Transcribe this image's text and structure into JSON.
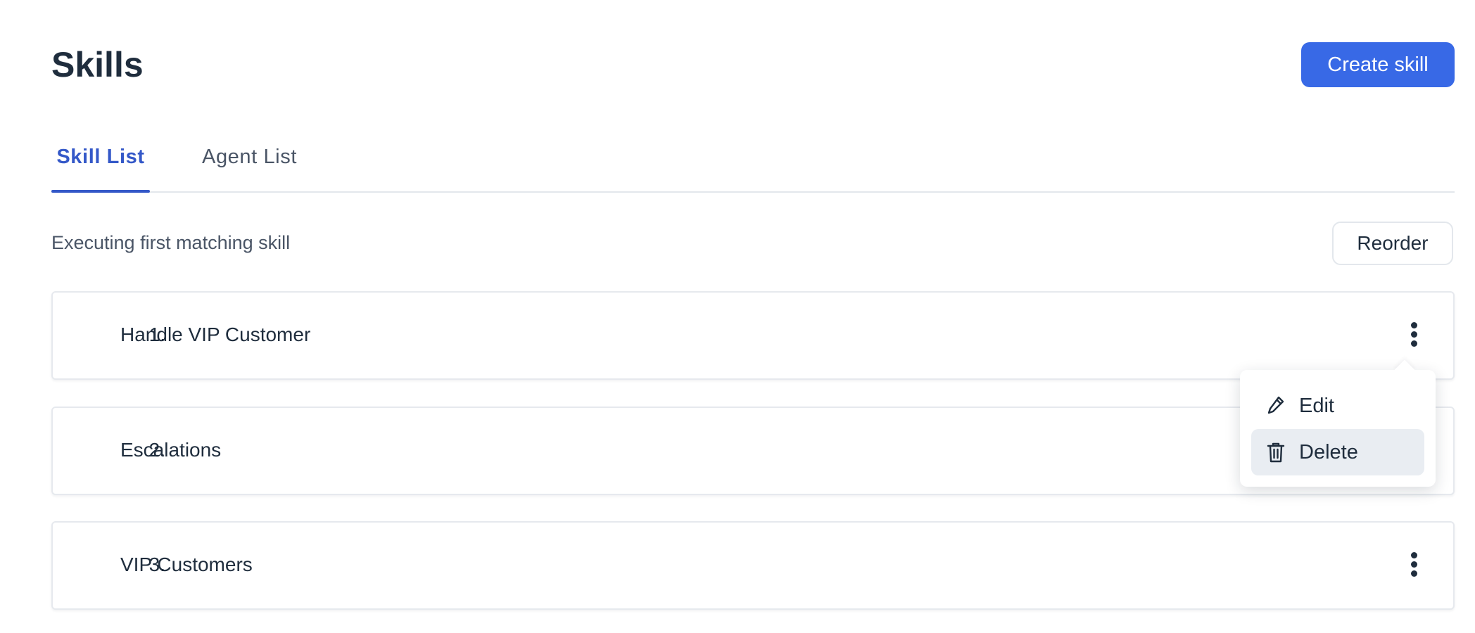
{
  "header": {
    "title": "Skills",
    "create_button": "Create skill"
  },
  "tabs": [
    {
      "label": "Skill List",
      "active": true
    },
    {
      "label": "Agent List",
      "active": false
    }
  ],
  "toolbar": {
    "status": "Executing first matching skill",
    "reorder_button": "Reorder"
  },
  "skills": [
    {
      "number": "1.",
      "name": "Handle VIP Customer"
    },
    {
      "number": "2.",
      "name": "Escalations"
    },
    {
      "number": "3.",
      "name": "VIP Customers"
    }
  ],
  "context_menu": {
    "items": [
      {
        "label": "Edit",
        "icon": "pencil-icon"
      },
      {
        "label": "Delete",
        "icon": "trash-icon"
      }
    ]
  },
  "colors": {
    "primary": "#3869e6",
    "active_tab": "#3458c8",
    "text": "#1f2d3d",
    "muted_text": "#4a5566",
    "border": "#e3e7ec",
    "menu_highlight": "#e9edf2"
  }
}
